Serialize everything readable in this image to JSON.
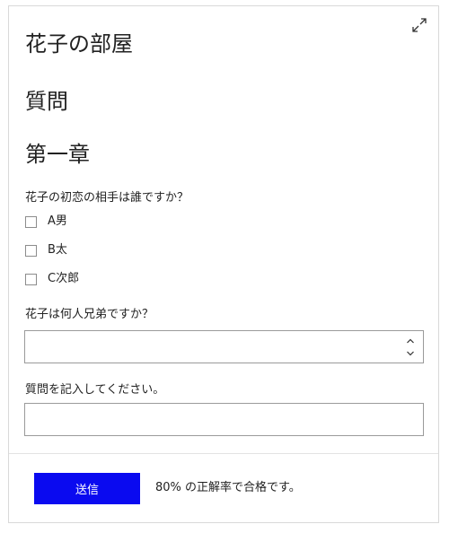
{
  "room": {
    "title": "花子の部屋"
  },
  "section": {
    "title": "質問"
  },
  "chapter": {
    "title": "第一章"
  },
  "question1": {
    "label": "花子の初恋の相手は誰ですか？",
    "options": [
      {
        "label": "A男",
        "checked": false
      },
      {
        "label": "B太",
        "checked": false
      },
      {
        "label": "C次郎",
        "checked": false
      }
    ]
  },
  "question2": {
    "label": "花子は何人兄弟ですか？",
    "value": ""
  },
  "question3": {
    "label": "質問を記入してください。",
    "value": ""
  },
  "footer": {
    "submit_label": "送信",
    "pass_note": "80% の正解率で合格です。"
  },
  "icons": {
    "expand": "expand-icon",
    "stepper_up": "chevron-up-icon",
    "stepper_down": "chevron-down-icon"
  },
  "colors": {
    "accent": "#0a0af0",
    "border": "#9a9a9a",
    "text": "#222222"
  }
}
